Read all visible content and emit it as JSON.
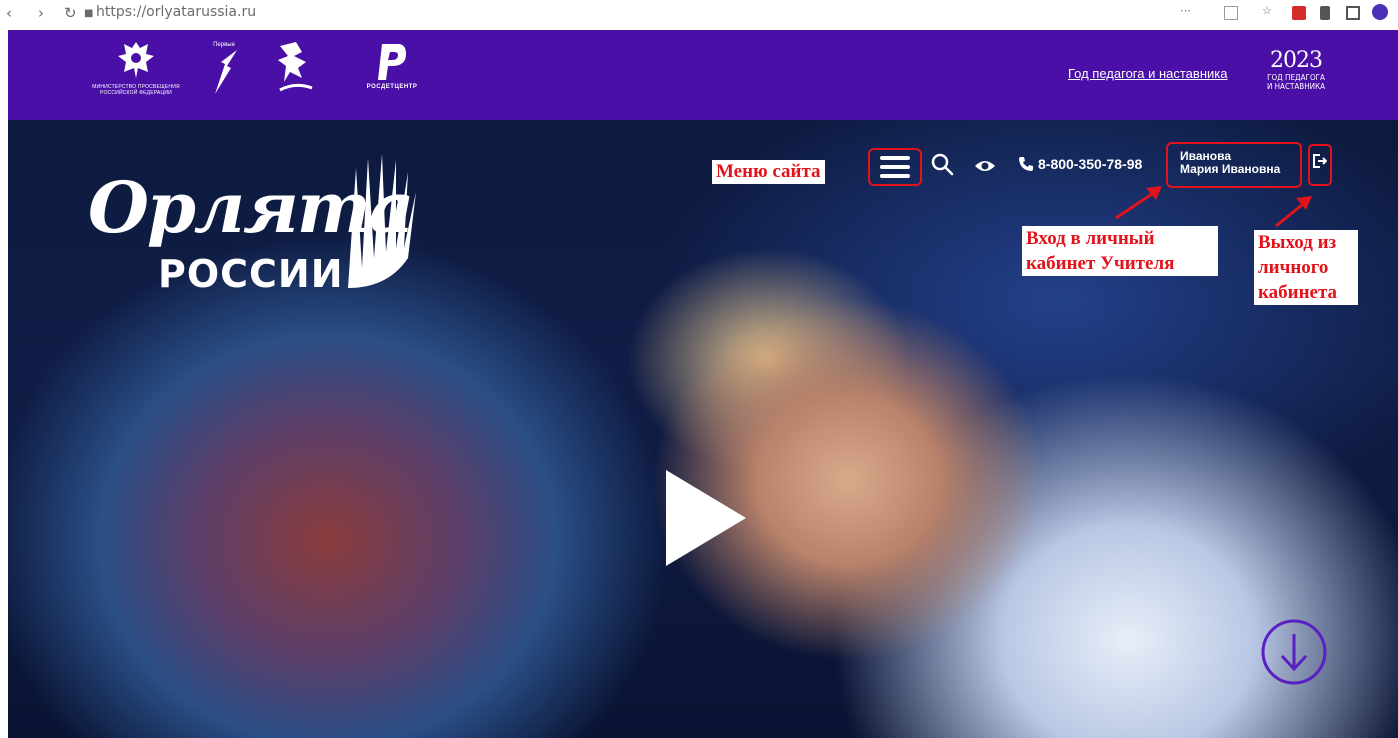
{
  "browser": {
    "url": "https://orlyatarussia.ru",
    "icons": [
      "back-icon",
      "forward-icon",
      "reload-icon",
      "lock-icon",
      "extensions-icon",
      "bookmark-icon",
      "profile-icon"
    ]
  },
  "header": {
    "year_link": "Год педагога и наставника",
    "partners": {
      "ministry_caption": "МИНИСТЕРСТВО ПРОСВЕЩЕНИЯ РОССИЙСКОЙ ФЕДЕРАЦИИ",
      "pervye_caption": "Первые",
      "rosdet_caption": "РОСДЕТЦЕНТР"
    },
    "year_badge": {
      "number": "2023",
      "caption_line1": "ГОД ПЕДАГОГА",
      "caption_line2": "И НАСТАВНИКА"
    }
  },
  "hero": {
    "logo_script": "Орлята",
    "logo_caps": "РОССИИ",
    "menu_annotation": "Меню сайта",
    "phone": "8-800-350-78-98",
    "user": {
      "last_name": "Иванова",
      "first_middle": "Мария Ивановна"
    },
    "annotations": {
      "cabinet_line1": "Вход в личный",
      "cabinet_line2": "кабинет Учителя",
      "exit_line1": "Выход из",
      "exit_line2": "личного",
      "exit_line3": "кабинета"
    }
  },
  "colors": {
    "header_bg": "#4a0fa6",
    "annotation_red": "#e2131b",
    "scroll_button": "#5a1fc4"
  }
}
